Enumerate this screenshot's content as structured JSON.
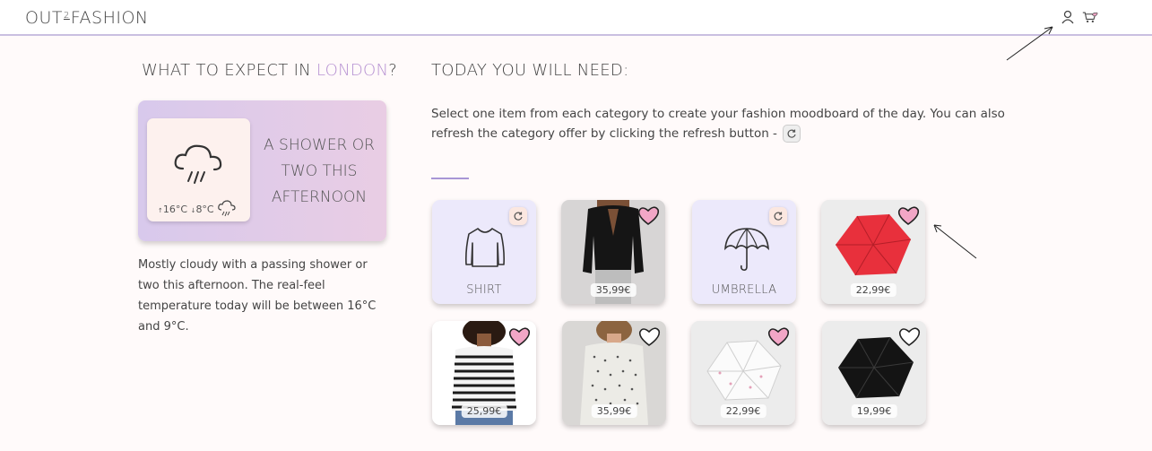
{
  "header": {
    "logo_left": "OUT",
    "logo_two": "2",
    "logo_right": "FASHION"
  },
  "weather": {
    "heading_prefix": "WHAT TO EXPECT IN ",
    "city": "LONDON",
    "heading_suffix": "?",
    "temp_high": "16°C",
    "temp_low": "8°C",
    "forecast_title": "A SHOWER OR TWO THIS AFTERNOON",
    "description": "Mostly cloudy with a passing shower or two this afternoon. The real-feel temperature today will be between 16°C and 9°C."
  },
  "main": {
    "heading": "TODAY YOU WILL NEED:",
    "instructions": "Select one item from each category to create your fashion moodboard of the day. You can also refresh the category offer by clicking the refresh button -"
  },
  "categories": {
    "shirt": "SHIRT",
    "umbrella": "UMBRELLA"
  },
  "products": [
    {
      "price": "35,99€",
      "liked": true
    },
    {
      "price": "22,99€",
      "liked": true
    },
    {
      "price": "25,99€",
      "liked": true
    },
    {
      "price": "35,99€",
      "liked": false
    },
    {
      "price": "22,99€",
      "liked": true
    },
    {
      "price": "19,99€",
      "liked": false
    }
  ],
  "colors": {
    "accent": "#b792d2",
    "heart_pink": "#f2a6c6",
    "category_bg": "#ece9fb"
  }
}
